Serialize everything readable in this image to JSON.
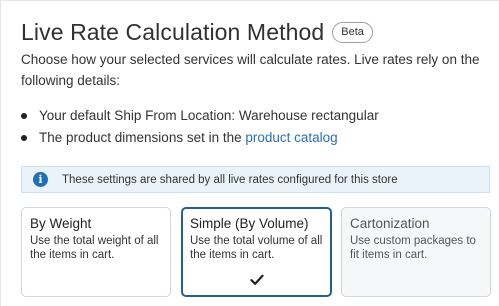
{
  "header": {
    "title": "Live Rate Calculation Method",
    "badge": "Beta"
  },
  "description": "Choose how your selected services will calculate rates. Live rates rely on the following details:",
  "bullets": {
    "item1": "Your default Ship From Location: Warehouse rectangular",
    "item2_text": "The product dimensions set in the ",
    "item2_link": "product catalog"
  },
  "info_banner": {
    "icon": "info-icon",
    "text": "These settings are shared by all live rates configured for this store"
  },
  "options": [
    {
      "title": "By Weight",
      "description": "Use the total weight of all the items in cart.",
      "selected": false
    },
    {
      "title": "Simple (By Volume)",
      "description": "Use the total volume of all the items in cart.",
      "selected": true
    },
    {
      "title": "Cartonization",
      "description": "Use custom packages to fit items in cart.",
      "selected": false
    }
  ],
  "colors": {
    "link": "#2a6fb8",
    "selected_border": "#245f92",
    "info_background": "#eaf3fa",
    "info_icon": "#1f6fb6"
  }
}
